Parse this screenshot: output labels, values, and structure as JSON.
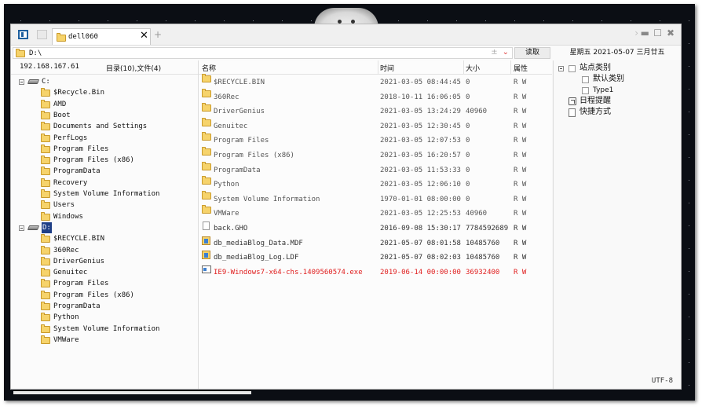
{
  "tab": {
    "label": "dell060"
  },
  "address": {
    "path": "D:\\"
  },
  "toolbar": {
    "read_label": "读取"
  },
  "datetime": {
    "text": "星期五  2021-05-07  三月廿五"
  },
  "left": {
    "ip": "192.168.167.61",
    "counts": "目录(10),文件(4)",
    "c_drive": "C:",
    "c_items": [
      "$Recycle.Bin",
      "AMD",
      "Boot",
      "Documents and Settings",
      "PerfLogs",
      "Program Files",
      "Program Files (x86)",
      "ProgramData",
      "Recovery",
      "System Volume Information",
      "Users",
      "Windows"
    ],
    "d_drive": "D:",
    "d_items": [
      "$RECYCLE.BIN",
      "360Rec",
      "DriverGenius",
      "Genuitec",
      "Program Files",
      "Program Files (x86)",
      "ProgramData",
      "Python",
      "System Volume Information",
      "VMWare"
    ]
  },
  "columns": {
    "name": "名称",
    "time": "时间",
    "size": "大小",
    "attr": "属性"
  },
  "files": [
    {
      "name": "$RECYCLE.BIN",
      "time": "2021-03-05 08:44:45",
      "size": "0",
      "attr": "R W",
      "icon": "folder-icon",
      "color": "#555555"
    },
    {
      "name": "360Rec",
      "time": "2018-10-11 16:06:05",
      "size": "0",
      "attr": "R W",
      "icon": "folder-icon",
      "color": "#555555"
    },
    {
      "name": "DriverGenius",
      "time": "2021-03-05 13:24:29",
      "size": "40960",
      "attr": "R W",
      "icon": "folder-icon",
      "color": "#555555"
    },
    {
      "name": "Genuitec",
      "time": "2021-03-05 12:30:45",
      "size": "0",
      "attr": "R W",
      "icon": "folder-icon",
      "color": "#555555"
    },
    {
      "name": "Program Files",
      "time": "2021-03-05 12:07:53",
      "size": "0",
      "attr": "R W",
      "icon": "folder-icon",
      "color": "#555555"
    },
    {
      "name": "Program Files (x86)",
      "time": "2021-03-05 16:20:57",
      "size": "0",
      "attr": "R W",
      "icon": "folder-icon",
      "color": "#555555"
    },
    {
      "name": "ProgramData",
      "time": "2021-03-05 11:53:33",
      "size": "0",
      "attr": "R W",
      "icon": "folder-icon",
      "color": "#555555"
    },
    {
      "name": "Python",
      "time": "2021-03-05 12:06:10",
      "size": "0",
      "attr": "R W",
      "icon": "folder-icon",
      "color": "#555555"
    },
    {
      "name": "System Volume Information",
      "time": "1970-01-01 08:00:00",
      "size": "0",
      "attr": "R W",
      "icon": "folder-icon",
      "color": "#555555"
    },
    {
      "name": "VMWare",
      "time": "2021-03-05 12:25:53",
      "size": "40960",
      "attr": "R W",
      "icon": "folder-icon",
      "color": "#555555"
    },
    {
      "name": "back.GHO",
      "time": "2016-09-08 15:30:17",
      "size": "7784592689",
      "attr": "R W",
      "icon": "file-icon",
      "color": "#333333"
    },
    {
      "name": "db_mediaBlog_Data.MDF",
      "time": "2021-05-07 08:01:58",
      "size": "10485760",
      "attr": "R W",
      "icon": "database-icon",
      "color": "#333333"
    },
    {
      "name": "db_mediaBlog_Log.LDF",
      "time": "2021-05-07 08:02:03",
      "size": "10485760",
      "attr": "R W",
      "icon": "database-icon",
      "color": "#333333"
    },
    {
      "name": "IE9-Windows7-x64-chs.1409560574.exe",
      "time": "2019-06-14 00:00:00",
      "size": "36932400",
      "attr": "R W",
      "icon": "exe-icon",
      "color": "#e02020"
    }
  ],
  "right": {
    "site_category": "站点类别",
    "default_category": "默认类别",
    "type1": "Type1",
    "schedule": "日程提醒",
    "shortcut": "快捷方式"
  },
  "status": {
    "encoding": "UTF-8"
  }
}
